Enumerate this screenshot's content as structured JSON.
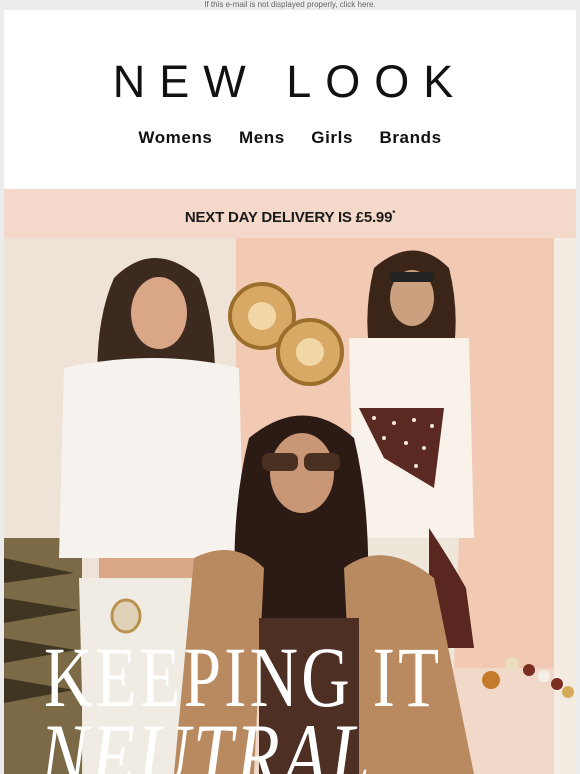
{
  "top_note": "If this e-mail is not displayed properly, click here.",
  "brand": {
    "logo_text": "NEW LOOK"
  },
  "nav": {
    "items": [
      "Womens",
      "Mens",
      "Girls",
      "Brands"
    ]
  },
  "banner": {
    "text": "NEXT DAY DELIVERY IS £5.99",
    "sup": "*"
  },
  "hero": {
    "headline_line1": "KEEPING IT",
    "headline_line2": "NEUTRAL"
  },
  "colors": {
    "banner_bg": "#f4d8c9",
    "hero_bg": "#f3e9df",
    "text": "#111111"
  }
}
